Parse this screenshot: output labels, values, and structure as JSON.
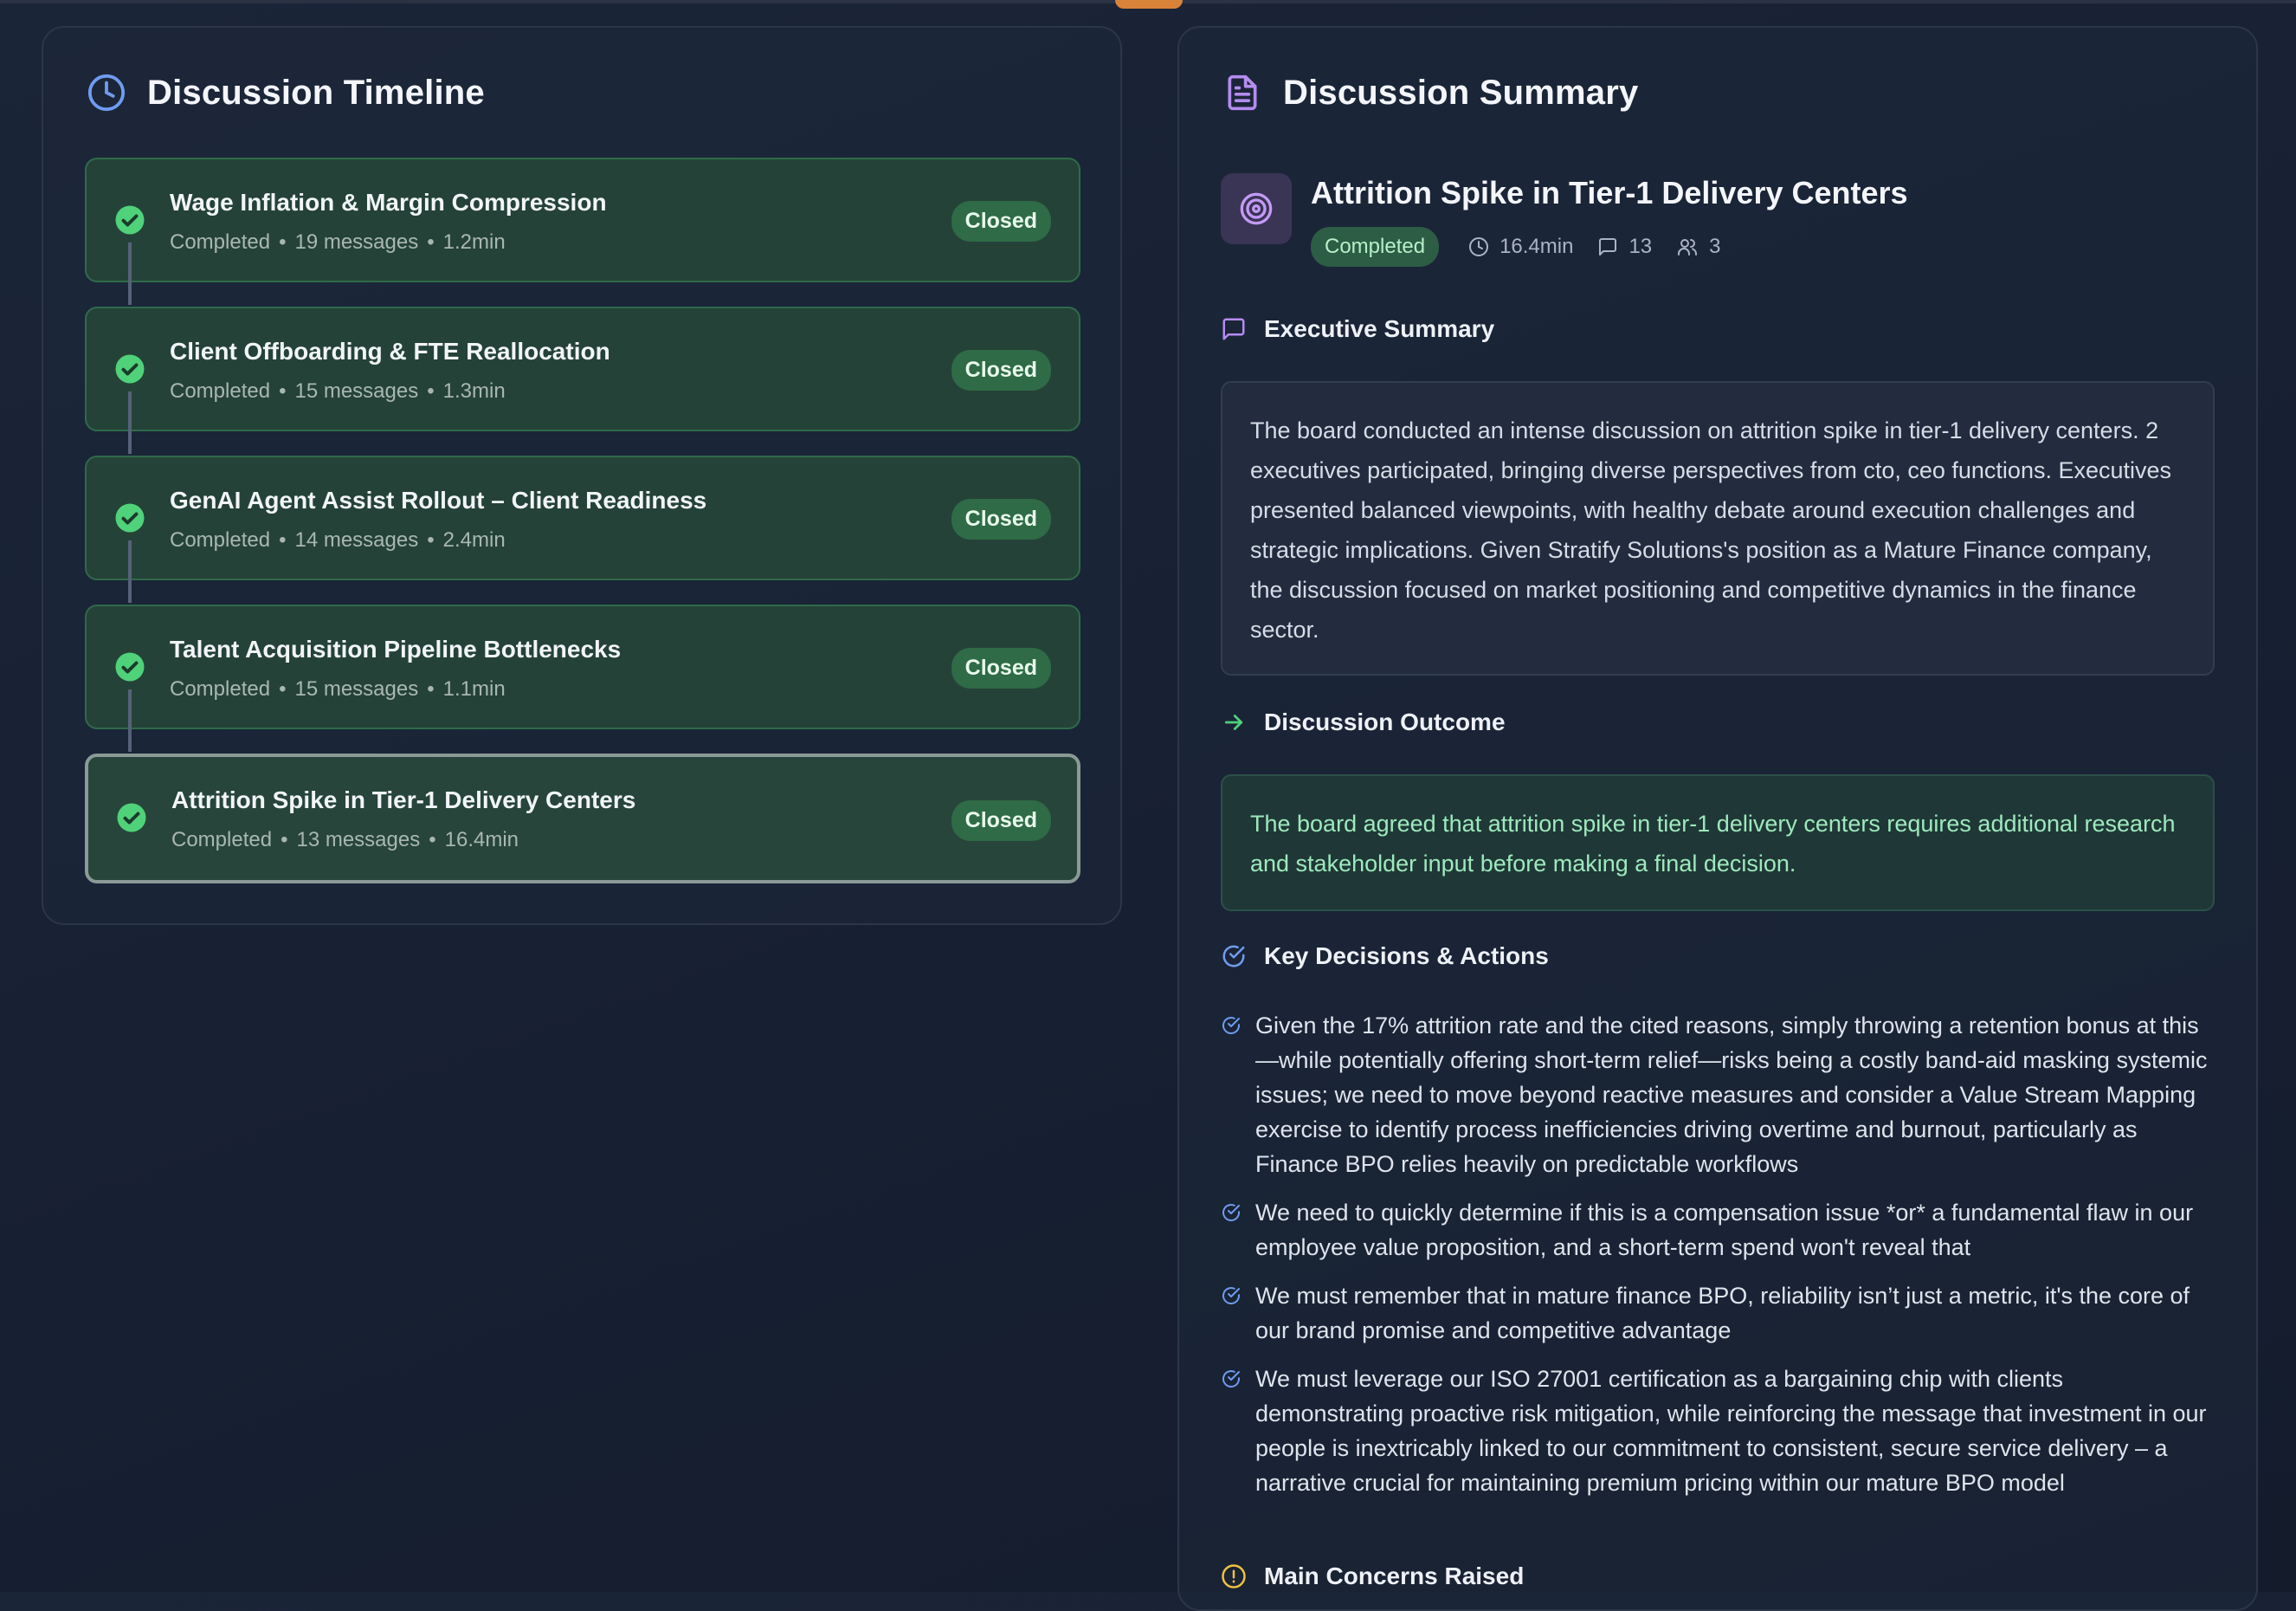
{
  "timeline": {
    "title": "Discussion Timeline",
    "items": [
      {
        "title": "Wage Inflation & Margin Compression",
        "status": "Completed",
        "messages": "19 messages",
        "duration": "1.2min",
        "badge": "Closed"
      },
      {
        "title": "Client Offboarding & FTE Reallocation",
        "status": "Completed",
        "messages": "15 messages",
        "duration": "1.3min",
        "badge": "Closed"
      },
      {
        "title": "GenAI Agent Assist Rollout – Client Readiness",
        "status": "Completed",
        "messages": "14 messages",
        "duration": "2.4min",
        "badge": "Closed"
      },
      {
        "title": "Talent Acquisition Pipeline Bottlenecks",
        "status": "Completed",
        "messages": "15 messages",
        "duration": "1.1min",
        "badge": "Closed"
      },
      {
        "title": "Attrition Spike in Tier-1 Delivery Centers",
        "status": "Completed",
        "messages": "13 messages",
        "duration": "16.4min",
        "badge": "Closed"
      }
    ]
  },
  "summary": {
    "title": "Discussion Summary",
    "topic": {
      "title": "Attrition Spike in Tier-1 Delivery Centers",
      "status": "Completed",
      "duration": "16.4min",
      "messages": "13",
      "participants": "3"
    },
    "executive": {
      "title": "Executive Summary",
      "text": "The board conducted an intense discussion on attrition spike in tier-1 delivery centers. 2 executives participated, bringing diverse perspectives from cto, ceo functions. Executives presented balanced viewpoints, with healthy debate around execution challenges and strategic implications. Given Stratify Solutions's position as a Mature Finance company, the discussion focused on market positioning and competitive dynamics in the finance sector."
    },
    "outcome": {
      "title": "Discussion Outcome",
      "text": "The board agreed that attrition spike in tier-1 delivery centers requires additional research and stakeholder input before making a final decision."
    },
    "decisions": {
      "title": "Key Decisions & Actions",
      "items": [
        "Given the 17% attrition rate and the cited reasons, simply throwing a retention bonus at this—while potentially offering short-term relief—risks being a costly band-aid masking systemic issues; we need to move beyond reactive measures and consider a Value Stream Mapping exercise to identify process inefficiencies driving overtime and burnout, particularly as Finance BPO relies heavily on predictable workflows",
        "We need to quickly determine if this is a compensation issue *or* a fundamental flaw in our employee value proposition, and a short-term spend won't reveal that",
        "We must remember that in mature finance BPO, reliability isn’t just a metric, it's the core of our brand promise and competitive advantage",
        "We must leverage our ISO 27001 certification as a bargaining chip with clients demonstrating proactive risk mitigation, while reinforcing the message that investment in our people is inextricably linked to our commitment to consistent, secure service delivery – a narrative crucial for maintaining premium pricing within our mature BPO model"
      ]
    },
    "concerns": {
      "title": "Main Concerns Raised"
    }
  },
  "colors": {
    "accent_green": "#4fd27a",
    "accent_purple": "#b58cf0",
    "accent_blue": "#6f9cf0",
    "warning_yellow": "#f0c040"
  },
  "icons": {
    "timeline": "clock-icon",
    "summary": "document-icon",
    "topic": "target-icon",
    "executive": "message-square-icon",
    "outcome": "arrow-right-icon",
    "decisions": "check-circle-icon",
    "concerns": "alert-circle-icon"
  }
}
